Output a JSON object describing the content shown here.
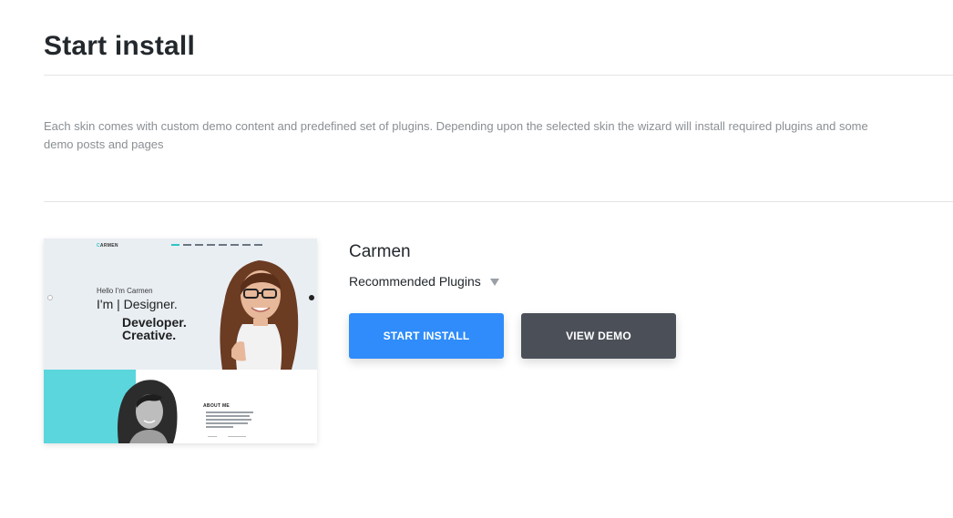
{
  "page": {
    "title": "Start install",
    "description": "Each skin comes with custom demo content and predefined set of plugins. Depending upon the selected skin the wizard will install required plugins and some demo posts and pages"
  },
  "skin": {
    "name": "Carmen",
    "plugins_label": "Recommended Plugins",
    "start_install_label": "START INSTALL",
    "view_demo_label": "VIEW DEMO",
    "preview": {
      "logo": "ARMEN",
      "hello": "Hello I'm Carmen",
      "line1": "I'm | Designer.",
      "line2": "Developer.",
      "line3": "Creative.",
      "about_title": "ABOUT ME"
    }
  },
  "colors": {
    "primary_button": "#2f8cfa",
    "secondary_button": "#4b5058",
    "accent_teal": "#5ad6dc"
  },
  "icons": {
    "plugins_toggle": "caret-down-icon"
  }
}
